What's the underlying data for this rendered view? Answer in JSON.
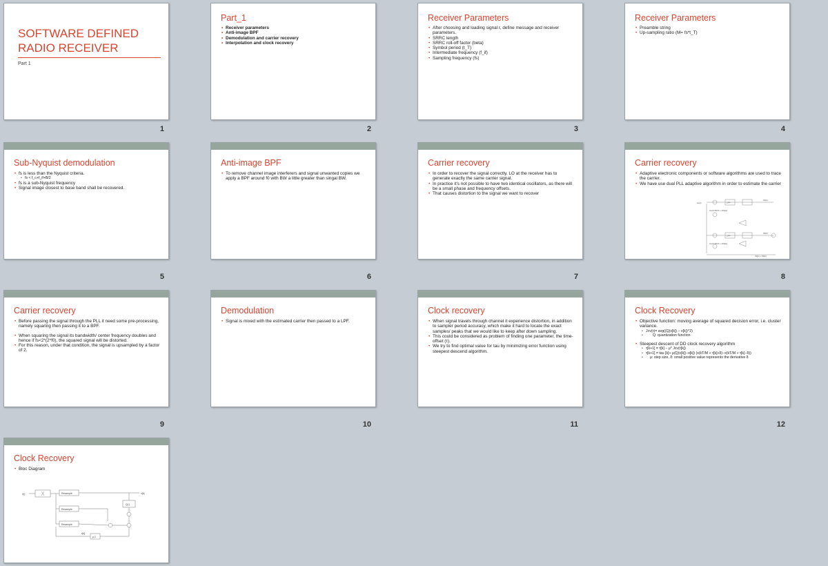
{
  "slides": [
    {
      "num": "1",
      "title": "SOFTWARE DEFINED RADIO RECEIVER",
      "subtitle": "Part 1"
    },
    {
      "num": "2",
      "title": "Part_1",
      "bullets": [
        "Receiver parameters",
        "Anti-image BPF",
        "Demodulation and carrier recovery",
        "Interpolation and clock recovery"
      ]
    },
    {
      "num": "3",
      "title": "Receiver Parameters",
      "bullets": [
        "After choosing and loading signal r, define message and receiver parameters.",
        "SRRC length",
        "SRRC roll-off factor (beta)",
        "Symbol period (t_T)",
        "Intermediate frequency (f_if)",
        "Sampling frequency (fs)"
      ]
    },
    {
      "num": "4",
      "title": "Receiver Parameters",
      "bullets": [
        "Preamble string",
        "Up-sampling ratio (M= fs*t_T)"
      ]
    },
    {
      "num": "5",
      "title": "Sub-Nyquist demodulation",
      "bullets": [
        "fs is less than the Nyquist criteria.",
        "fs is a sub-Nyquist frequency",
        "Signal image closest to base band shall be recovered."
      ],
      "sub": "fs < f_c+f_if+B/2"
    },
    {
      "num": "6",
      "title": "Anti-image BPF",
      "bullets": [
        "To remove channel image interferers and signal unwanted copies we apply a BPF around f0 with BW a little greater than singal BW."
      ]
    },
    {
      "num": "7",
      "title": "Carrier recovery",
      "bullets": [
        "In order to recover the signal correctly, LO at the receiver has to generate exactly the same carrier signal.",
        "In practice it's not possible to have two identical oscillators, as there will be a small phase and frequency offsets.",
        "That causes distortion to the signal we want to recover"
      ]
    },
    {
      "num": "8",
      "title": "Carrier recovery",
      "bullets": [
        "Adaptive electronic components or software algorithms are used to trace the carrier.",
        "We have use dual PLL adaptive algorithm in order to estimate the carrier"
      ],
      "diagram": {
        "input": "ws(t)",
        "lpf": "LPF",
        "block1": "sin(4πf0kTs + 2θ1[k])",
        "block2": "sin(4πf0kTs + 2θ2[k])",
        "out1": "θ1[k]",
        "out2": "θ2[k]",
        "sum": "θ1[k] + θ2[k]"
      }
    },
    {
      "num": "9",
      "title": "Carrier recovery",
      "bullets": [
        "Before passing the signal through the PLL it need some pre-processing, namely squaring then passing it to a BPF.",
        "When squaring the signal its bandwidth/ center frequency doubles and hence if fs<2*(2*f0), the squared signal will be distorted.",
        "For this reason, under that condition, the signal is upsampled by a factor of 2."
      ]
    },
    {
      "num": "10",
      "title": "Demodulation",
      "bullets": [
        "Signal is mixed with the estimated carrier then passed to a LPF."
      ]
    },
    {
      "num": "11",
      "title": "Clock recovery",
      "bullets": [
        "When signal travels through channel it experience distortion, in addition to sampler period accuracy, which make it hard to locate the exact samples/ peaks that we would like to keep after down sampling.",
        "This could be considered as problem of finding one parameter, the time-offset (τ).",
        "We try to find optimal value for tau by minimizing error function using steepest descend algorithm."
      ]
    },
    {
      "num": "12",
      "title": "Clock Recovery",
      "bullets": [
        "Objective function: moving average of squared decision error, i.e. cluster variance.",
        "Steepest descent of DD clock recovery algorithm"
      ],
      "subs1": [
        "Jcv(τ)= avg((Q(x[k]) − x[k])^2)",
        "Q: quantization function"
      ],
      "subs2": [
        "τ[k+1] = τ[k] − μ* Jcv(τ[k])",
        "τ[k+1] = tau [k]+ μ(Q(x[k])−x[k]) (x(kT/M + τ[k]+δ)−x(kT/M + τ[k]−δ))",
        "μ: step size, δ: small positive value represents the derivative δ"
      ]
    },
    {
      "num": "",
      "title": "Clock Recovery",
      "bullets": [
        "Bloc Diagram"
      ],
      "diagram": {
        "input": "r(t)",
        "output": "x[k]",
        "resample": "Resample",
        "q": "Q(·)",
        "mu": "μ Σ",
        "tau": "τ[k]"
      }
    }
  ]
}
